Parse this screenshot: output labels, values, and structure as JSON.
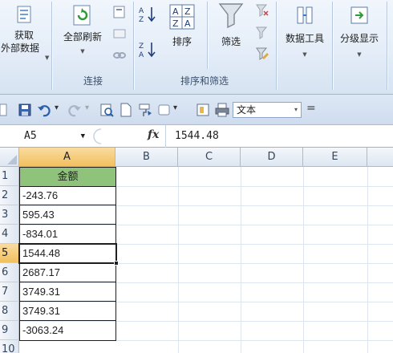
{
  "ribbon": {
    "get_external_line1": "获取",
    "get_external_line2": "外部数据",
    "refresh_all": "全部刷新",
    "sort": "排序",
    "filter": "筛选",
    "data_tools": "数据工具",
    "outline": "分级显示",
    "group_connections": "连接",
    "group_sort_filter": "排序和筛选",
    "sort_az_icon": "sort-ascending-icon",
    "sort_za_icon": "sort-descending-icon",
    "filter_icon": "funnel-icon"
  },
  "qat": {
    "number_format": "文本",
    "dropdown_glyph": "▾",
    "more_glyph": "="
  },
  "formula_bar": {
    "name_box": "A5",
    "fx": "fx",
    "formula": "1544.48"
  },
  "grid": {
    "columns": [
      "A",
      "B",
      "C",
      "D",
      "E"
    ],
    "rows": [
      "1",
      "2",
      "3",
      "4",
      "5",
      "6",
      "7",
      "8",
      "9",
      "10"
    ],
    "selected_row": "5",
    "selected_column": "A",
    "header_cell": "金额",
    "values": [
      "-243.76",
      "595.43",
      "-834.01",
      "1544.48",
      "2687.17",
      "3749.31",
      "3749.31",
      "-3063.24"
    ]
  },
  "colors": {
    "header_fill": "#8fc27a",
    "selection_border": "#1f1f1f",
    "ribbon_bg": "#dfe9f5"
  }
}
